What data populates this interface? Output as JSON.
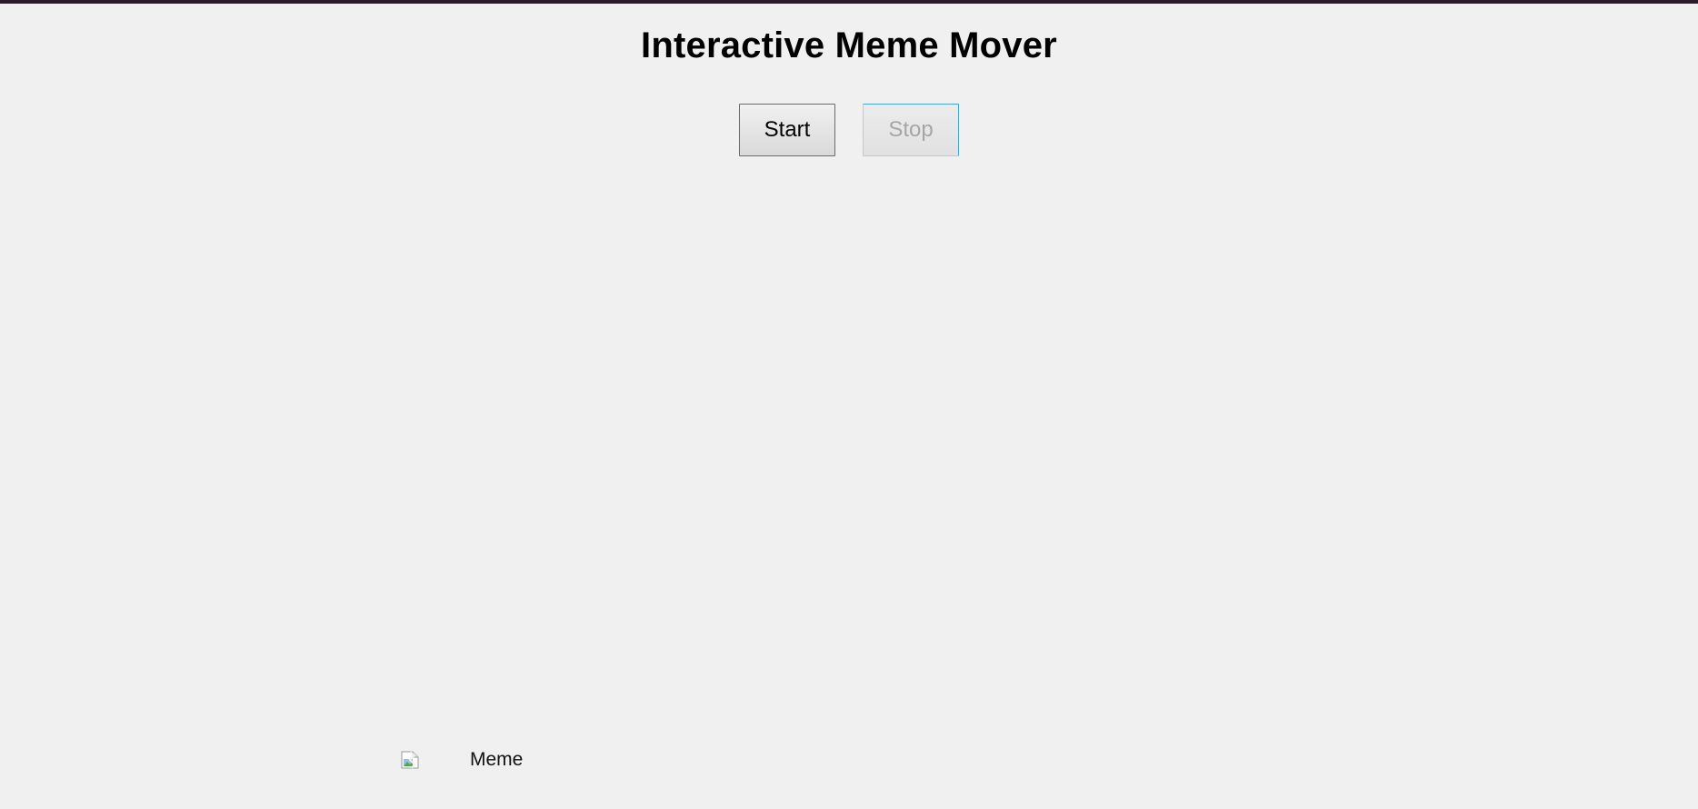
{
  "page": {
    "title": "Interactive Meme Mover"
  },
  "controls": {
    "start_label": "Start",
    "stop_label": "Stop",
    "stop_disabled": true
  },
  "meme": {
    "alt_text": "Meme",
    "icon": "broken-image-icon"
  },
  "colors": {
    "background": "#f0f0f0",
    "top_bar": "#2a1a2a",
    "focus_accent": "#4aa3d8",
    "disabled_text": "#a6a6a6"
  }
}
